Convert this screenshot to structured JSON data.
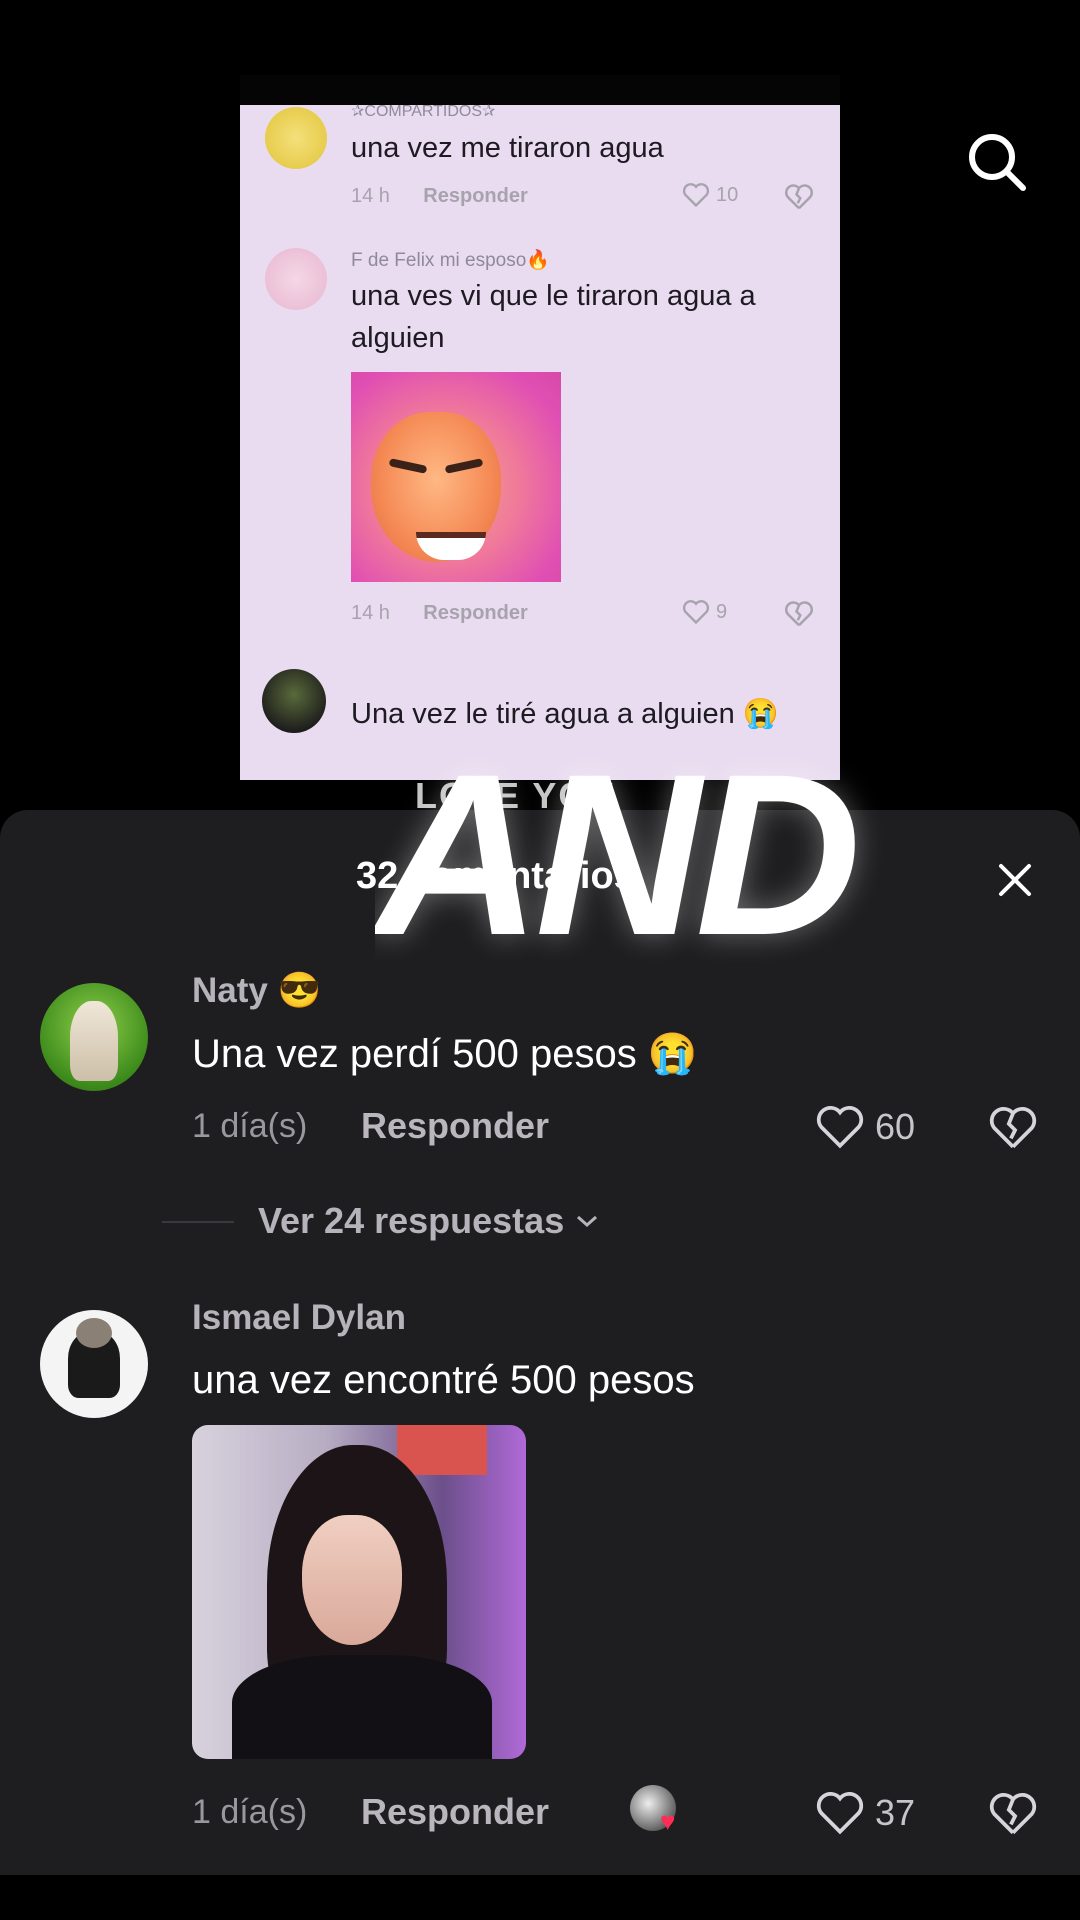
{
  "embed": {
    "comments": [
      {
        "user": "✰COMPARTIDOS✰",
        "text": "una vez me tiraron agua",
        "time": "14 h",
        "reply": "Responder",
        "likes": "10"
      },
      {
        "user": "F de Felix mi esposo🔥",
        "text": "una ves vi que le tiraron agua a alguien",
        "time": "14 h",
        "reply": "Responder",
        "likes": "9"
      },
      {
        "user": "",
        "text": "Una vez le tiré agua a alguien 😭"
      }
    ],
    "watermark": "LOVE YOU"
  },
  "overlay_text": "AND",
  "sheet": {
    "title": "32 comentarios"
  },
  "comments": [
    {
      "user": "Naty 😎",
      "text": "Una vez perdí 500 pesos 😭",
      "time": "1 día(s)",
      "reply": "Responder",
      "likes": "60",
      "view_replies": "Ver 24 respuestas"
    },
    {
      "user": "Ismael Dylan",
      "text": "una vez encontré 500 pesos",
      "time": "1 día(s)",
      "reply": "Responder",
      "likes": "37"
    }
  ],
  "colors": {
    "background": "#000000",
    "sheet": "#1e1e20",
    "embed_bg": "#e9dcf0"
  },
  "icons": [
    "search-icon",
    "close-icon",
    "heart-icon",
    "dislike-icon",
    "chevron-down-icon"
  ]
}
